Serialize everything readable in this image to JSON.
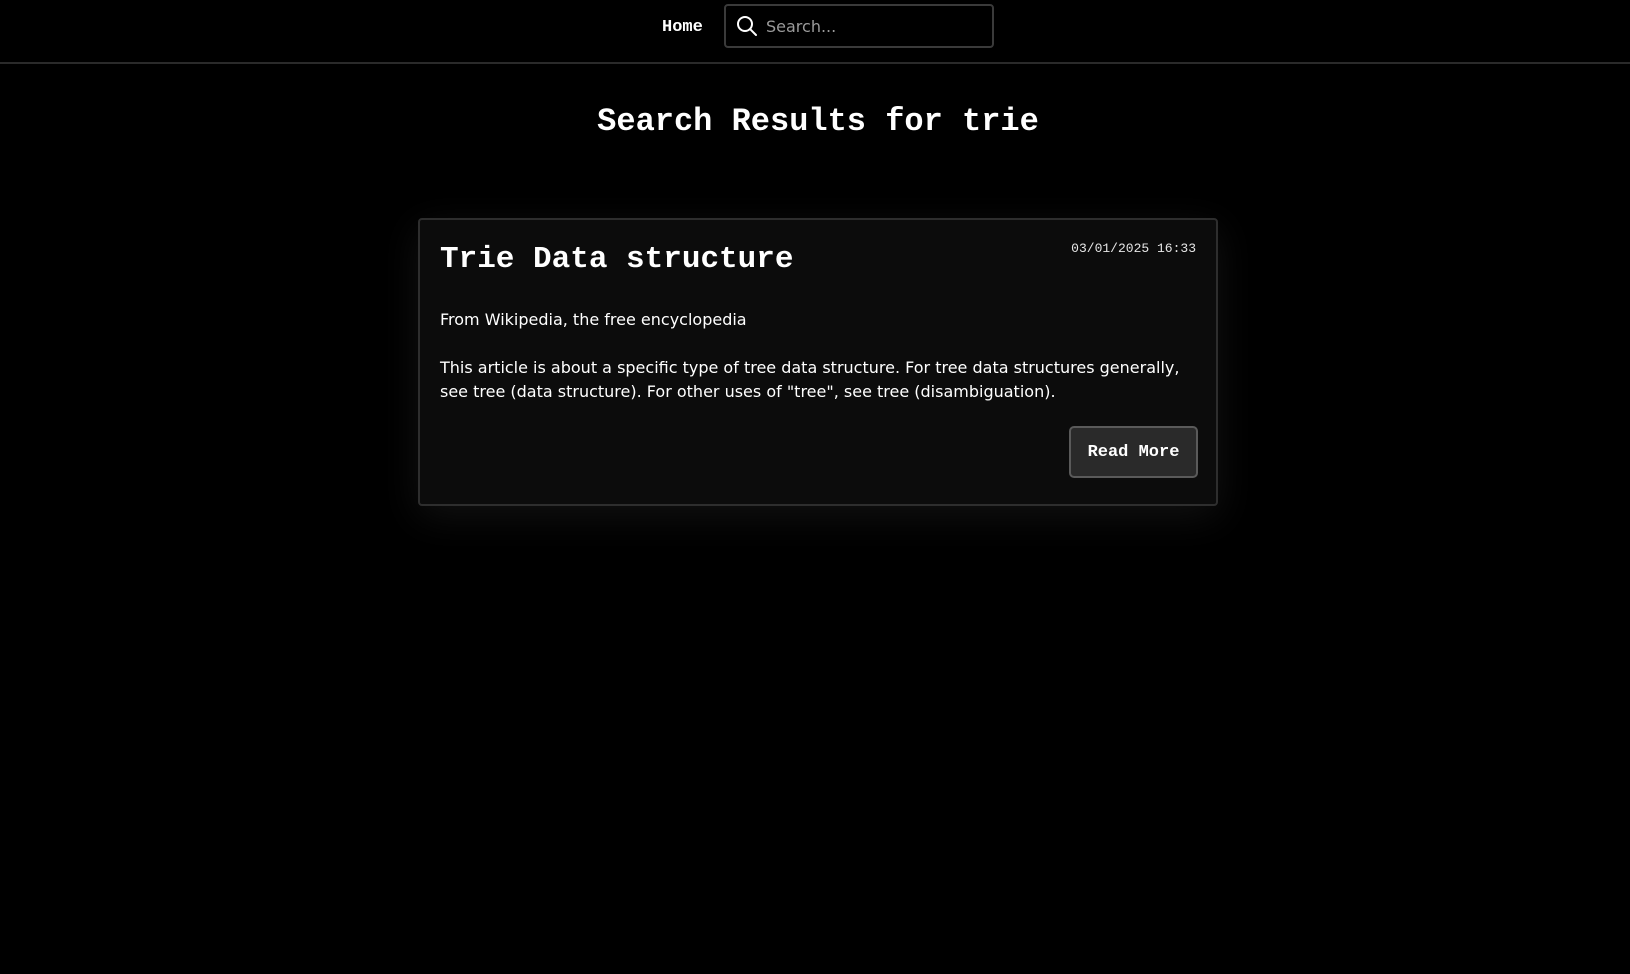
{
  "nav": {
    "home_label": "Home",
    "search": {
      "placeholder": "Search...",
      "value": "",
      "icon": "search-icon"
    }
  },
  "main": {
    "heading": "Search Results for trie",
    "results": [
      {
        "title": "Trie Data structure",
        "date": "03/01/2025 16:33",
        "source": "From Wikipedia, the free encyclopedia",
        "excerpt": "This article is about a specific type of tree data structure. For tree data structures generally, see tree (data structure). For other uses of \"tree\", see tree (disambiguation).",
        "read_more_label": "Read More"
      }
    ]
  },
  "colors": {
    "background": "#000000",
    "text": "#ffffff",
    "card_background": "#0c0c0c",
    "card_border": "#2e2e2e",
    "button_background": "#2a2a2a",
    "button_border": "#5a5a5a",
    "placeholder": "#9a9a9a"
  }
}
